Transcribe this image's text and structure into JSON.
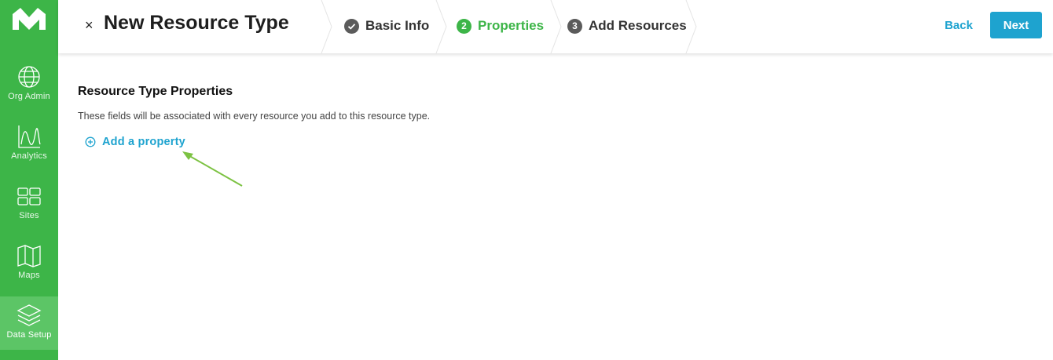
{
  "sidebar": {
    "items": [
      {
        "label": "Org Admin",
        "icon": "globe-icon",
        "active": false
      },
      {
        "label": "Analytics",
        "icon": "analytics-chart-icon",
        "active": false
      },
      {
        "label": "Sites",
        "icon": "sites-grid-icon",
        "active": false
      },
      {
        "label": "Maps",
        "icon": "map-icon",
        "active": false
      },
      {
        "label": "Data Setup",
        "icon": "layers-icon",
        "active": true
      }
    ]
  },
  "header": {
    "close_icon": "×",
    "title": "New Resource Type",
    "steps": [
      {
        "number": "✓",
        "label": "Basic Info",
        "state": "done"
      },
      {
        "number": "2",
        "label": "Properties",
        "state": "current"
      },
      {
        "number": "3",
        "label": "Add Resources",
        "state": "todo"
      }
    ],
    "back_label": "Back",
    "next_label": "Next"
  },
  "main": {
    "section_title": "Resource Type Properties",
    "section_description": "These fields will be associated with every resource you add to this resource type.",
    "add_property_label": "Add a property"
  },
  "colors": {
    "brand_green": "#3db548",
    "accent_blue": "#1ea3cf",
    "annotation_arrow": "#7cc242"
  }
}
